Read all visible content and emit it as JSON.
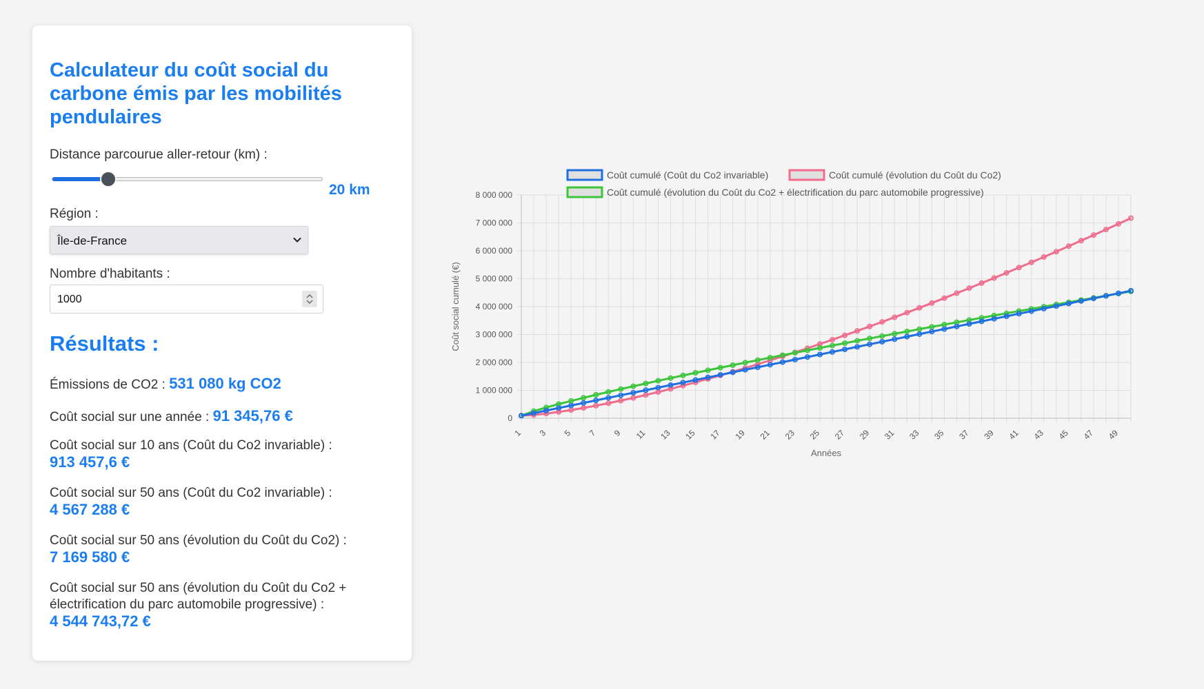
{
  "calculator": {
    "title": "Calculateur du coût social du carbone émis par les mobilités pendulaires",
    "distance_label": "Distance parcourue aller-retour (km) :",
    "distance_value": 20,
    "distance_display": "20 km",
    "region_label": "Région :",
    "region_selected": "Île-de-France",
    "habitants_label": "Nombre d'habitants :",
    "habitants_value": "1000"
  },
  "results": {
    "title": "Résultats :",
    "emissions_label": "Émissions de CO2 :",
    "emissions_value": "531 080 kg CO2",
    "annual_label": "Coût social sur une année :",
    "annual_value": "91 345,76 €",
    "ten_years_label": "Coût social sur 10 ans (Coût du Co2 invariable) :",
    "ten_years_value": "913 457,6 €",
    "fifty_invariable_label": "Coût social sur 50 ans (Coût du Co2 invariable) :",
    "fifty_invariable_value": "4 567 288 €",
    "fifty_evolution_label": "Coût social sur 50 ans (évolution du Coût du Co2) :",
    "fifty_evolution_value": "7 169 580 €",
    "fifty_electrification_label": "Coût social sur 50 ans (évolution du Coût du Co2 + électrification du parc automobile progressive) :",
    "fifty_electrification_value": "4 544 743,72 €"
  },
  "colors": {
    "accent": "#1a7ef0",
    "series_invariable": "#1f6fe0",
    "series_evolution": "#f06c8d",
    "series_electrification": "#3cc43c"
  },
  "chart_data": {
    "type": "line",
    "xlabel": "Années",
    "ylabel": "Coût social cumulé (€)",
    "ylim": [
      0,
      8000000
    ],
    "y_ticks": [
      "0",
      "1 000 000",
      "2 000 000",
      "3 000 000",
      "4 000 000",
      "5 000 000",
      "6 000 000",
      "7 000 000",
      "8 000 000"
    ],
    "x": [
      1,
      50
    ],
    "x_tick_labels": [
      "1",
      "3",
      "5",
      "7",
      "9",
      "11",
      "13",
      "15",
      "17",
      "19",
      "21",
      "23",
      "25",
      "27",
      "29",
      "31",
      "33",
      "35",
      "37",
      "39",
      "41",
      "43",
      "45",
      "47",
      "49"
    ],
    "grid": true,
    "legend_position": "top",
    "series": [
      {
        "name": "Coût cumulé (Coût du Co2 invariable)",
        "start": 91345.76,
        "end": 4567288,
        "growth": 1
      },
      {
        "name": "Coût cumulé (évolution du Coût du Co2)",
        "start": 91345.76,
        "end": 7169580,
        "growth": 1.42
      },
      {
        "name": "Coût cumulé (évolution du Coût du Co2 + électrification du parc automobile progressive)",
        "start": 91345.76,
        "end": 4544743.72,
        "growth": 0.85
      }
    ]
  }
}
